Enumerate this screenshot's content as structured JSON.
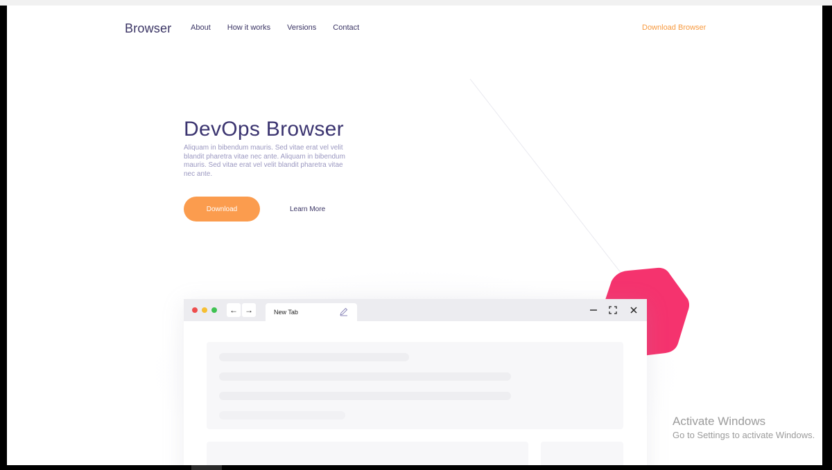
{
  "nav": {
    "brand": "Browser",
    "links": [
      "About",
      "How it works",
      "Versions",
      "Contact"
    ],
    "cta": "Download Browser"
  },
  "hero": {
    "title": "DevOps Browser",
    "description": "Aliquam in bibendum mauris. Sed vitae erat vel velit blandit pharetra vitae nec ante. Aliquam in bibendum mauris. Sed vitae erat vel velit blandit pharetra vitae nec ante.",
    "primary_button": "Download",
    "secondary_link": "Learn More"
  },
  "mockup": {
    "tab_label": "New Tab",
    "back_icon": "←",
    "forward_icon": "→",
    "minimize_icon": "—",
    "close_icon": "✕"
  },
  "watermark": {
    "title": "Activate Windows",
    "subtitle": "Go to Settings to activate Windows."
  },
  "colors": {
    "accent": "#fb9c4e",
    "brand_text": "#3b3470",
    "pink": "#f5336e"
  }
}
